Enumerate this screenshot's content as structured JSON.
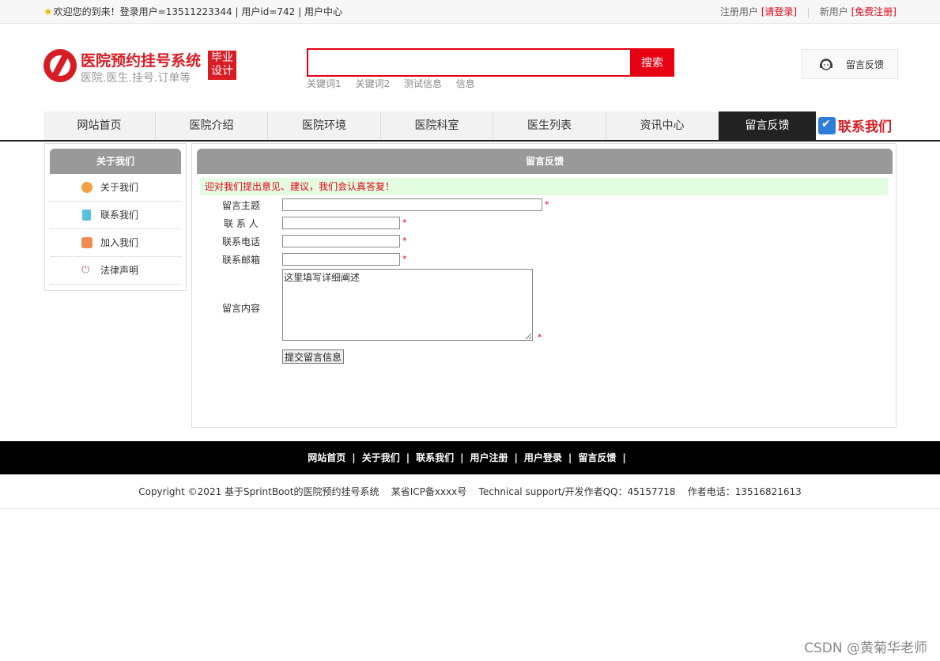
{
  "topbar": {
    "welcome": "欢迎您的到来！登录用户=13511223344 | 用户id=742 | 用户中心",
    "register_user": "注册用户",
    "please_login": "[请登录]",
    "new_user": "新用户",
    "free_register": "[免费注册]"
  },
  "logo": {
    "title": "医院预约挂号系统",
    "subtitle": "医院.医生.挂号.订单等",
    "badge_line1": "毕业",
    "badge_line2": "设计"
  },
  "search": {
    "value": "",
    "button": "搜索",
    "keywords": [
      "关键词1",
      "关键词2",
      "测试信息",
      "信息"
    ]
  },
  "header_feedback": {
    "label": "留言反馈",
    "icon": "support-headset-icon"
  },
  "nav": {
    "items": [
      "网站首页",
      "医院介绍",
      "医院环境",
      "医院科室",
      "医生列表",
      "资讯中心",
      "留言反馈"
    ],
    "active_index": 6,
    "contact": "联系我们",
    "contact_icon": "checkmark-icon"
  },
  "sidebar": {
    "title": "关于我们",
    "items": [
      {
        "label": "关于我们",
        "icon": "circle-icon",
        "color": "#f0a040"
      },
      {
        "label": "联系我们",
        "icon": "clipboard-icon",
        "color": "#5bc0de"
      },
      {
        "label": "加入我们",
        "icon": "lock-icon",
        "color": "#f08c50"
      },
      {
        "label": "法律声明",
        "icon": "power-icon",
        "color": "#b07070"
      }
    ]
  },
  "main": {
    "title": "留言反馈",
    "notice": "迎对我们提出意见、建议，我们会认真答复！",
    "form": {
      "subject_label": "留言主题",
      "contact_label": "联 系 人",
      "phone_label": "联系电话",
      "email_label": "联系邮箱",
      "content_label": "留言内容",
      "content_value": "这里填写详细阐述",
      "required_mark": "*",
      "submit": "提交留言信息"
    }
  },
  "footer": {
    "links": [
      "网站首页",
      "关于我们",
      "联系我们",
      "用户注册",
      "用户登录",
      "留言反馈"
    ],
    "separator": "|",
    "copyright": "Copyright ©2021 基于SprintBoot的医院预约挂号系统    某省ICP备xxxx号    Technical support/开发作者QQ：45157718    作者电话：13516821613"
  },
  "watermark": "CSDN @黄菊华老师",
  "colors": {
    "brand_red": "#e60012",
    "nav_active": "#222222",
    "notice_bg": "#e3fde3"
  }
}
